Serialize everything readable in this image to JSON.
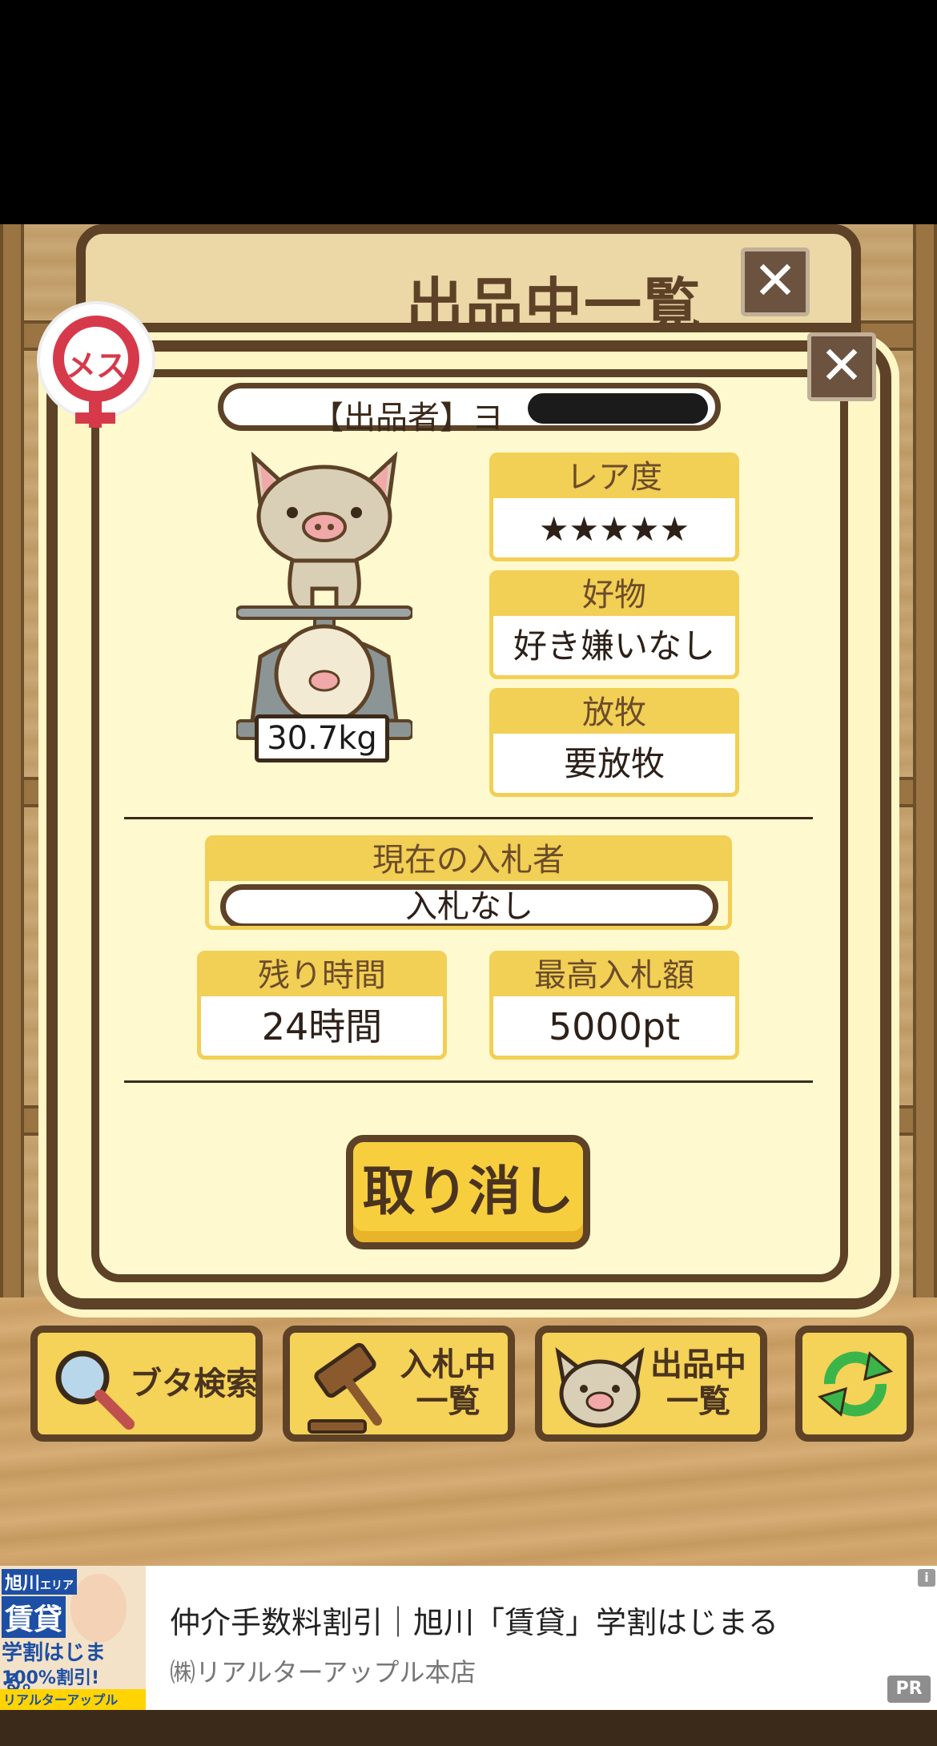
{
  "board": {
    "title": "出品中一覧"
  },
  "dialog": {
    "gender": "メス",
    "seller": "【出品者】ヨ",
    "weight": "30.7kg",
    "rarity": {
      "label": "レア度",
      "stars": "★★★★★",
      "count": 5
    },
    "favorite": {
      "label": "好物",
      "value": "好き嫌いなし"
    },
    "grazing": {
      "label": "放牧",
      "value": "要放牧"
    },
    "current_bidder": {
      "label": "現在の入札者",
      "value": "入札なし"
    },
    "remaining_time": {
      "label": "残り時間",
      "value": "24時間"
    },
    "highest_bid": {
      "label": "最高入札額",
      "value": "5000pt"
    },
    "cancel_label": "取り消し"
  },
  "toolbar": {
    "search_label": "ブタ検索",
    "bidding_line1": "入札中",
    "bidding_line2": "一覧",
    "listing_line1": "出品中",
    "listing_line2": "一覧"
  },
  "ad": {
    "image_area": "旭川",
    "image_area_suffix": "エリア",
    "image_headline": "賃貸",
    "image_sub": "学割はじまる。",
    "image_percent": "100%割引!",
    "image_brand": "リアルターアップル",
    "title": "仲介手数料割引｜旭川「賃貸」学割はじまる",
    "advertiser": "㈱リアルターアップル本店",
    "pr_label": "PR",
    "info_label": "i"
  },
  "colors": {
    "frame_brown": "#5d4227",
    "panel_cream": "#fff9d0",
    "card_yellow": "#f2cf55",
    "star_pink": "#e06666",
    "gender_red": "#d63a4a",
    "refresh_green": "#3bb54a"
  }
}
